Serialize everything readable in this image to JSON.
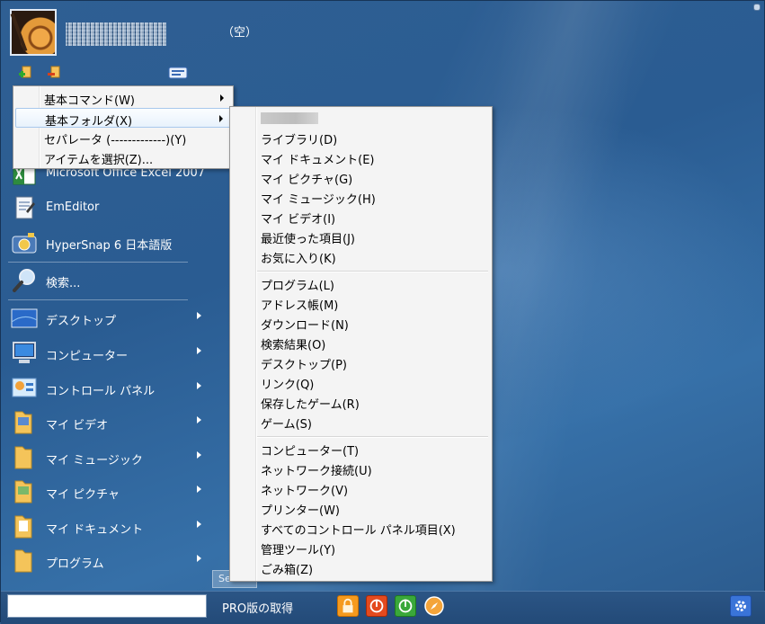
{
  "header": {
    "status_text": "（空）"
  },
  "left_menu": {
    "items": [
      {
        "label": "Microsoft Office Excel 2007",
        "icon": "excel-icon"
      },
      {
        "label": "EmEditor",
        "icon": "emeditor-icon"
      },
      {
        "label": "HyperSnap 6 日本語版",
        "icon": "hypersnap-icon"
      },
      {
        "label": "検索...",
        "icon": "search-magnifier-icon"
      },
      {
        "label": "デスクトップ",
        "icon": "desktop-icon"
      },
      {
        "label": "コンピューター",
        "icon": "computer-icon"
      },
      {
        "label": "コントロール パネル",
        "icon": "control-panel-icon"
      },
      {
        "label": "マイ ビデオ",
        "icon": "folder-icon"
      },
      {
        "label": "マイ ミュージック",
        "icon": "folder-icon"
      },
      {
        "label": "マイ ピクチャ",
        "icon": "folder-icon"
      },
      {
        "label": "マイ ドキュメント",
        "icon": "folder-icon"
      },
      {
        "label": "プログラム",
        "icon": "folder-icon"
      }
    ]
  },
  "context_menu": {
    "items": [
      {
        "label": "基本コマンド(W)"
      },
      {
        "label": "基本フォルダ(X)"
      },
      {
        "label": "セパレータ (-------------)(Y)"
      },
      {
        "label": "アイテムを選択(Z)..."
      }
    ]
  },
  "folder_menu": {
    "items": [
      {
        "label": "ライブラリ(D)"
      },
      {
        "label": "マイ ドキュメント(E)"
      },
      {
        "label": "マイ ピクチャ(G)"
      },
      {
        "label": "マイ ミュージック(H)"
      },
      {
        "label": "マイ ビデオ(I)"
      },
      {
        "label": "最近使った項目(J)"
      },
      {
        "label": "お気に入り(K)"
      },
      {
        "label": "プログラム(L)"
      },
      {
        "label": "アドレス帳(M)"
      },
      {
        "label": "ダウンロード(N)"
      },
      {
        "label": "検索結果(O)"
      },
      {
        "label": "デスクトップ(P)"
      },
      {
        "label": "リンク(Q)"
      },
      {
        "label": "保存したゲーム(R)"
      },
      {
        "label": "ゲーム(S)"
      },
      {
        "label": "コンピューター(T)"
      },
      {
        "label": "ネットワーク接続(U)"
      },
      {
        "label": "ネットワーク(V)"
      },
      {
        "label": "プリンター(W)"
      },
      {
        "label": "すべてのコントロール パネル項目(X)"
      },
      {
        "label": "管理ツール(Y)"
      },
      {
        "label": "ごみ箱(Z)"
      }
    ]
  },
  "bottom": {
    "search_value": "",
    "pro_label": "PRO版の取得",
    "search_tab": "Sea"
  }
}
